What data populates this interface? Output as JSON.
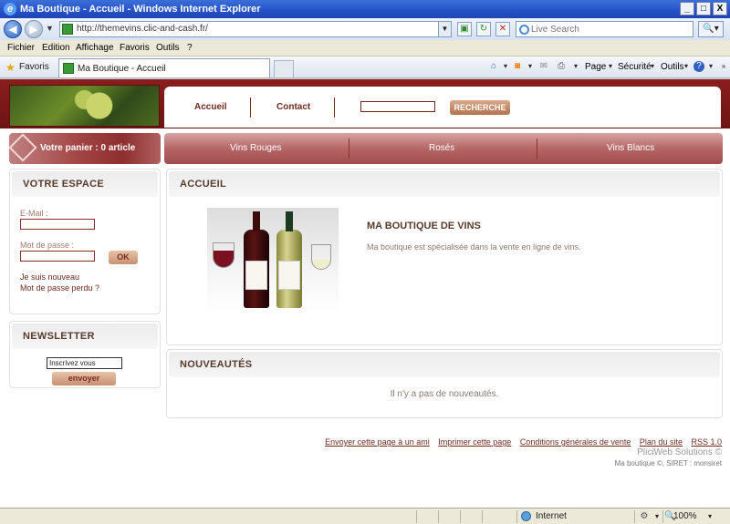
{
  "browser": {
    "window_title": "Ma Boutique - Accueil - Windows Internet Explorer",
    "window_buttons": [
      "_",
      "□",
      "X"
    ],
    "address": "http://themevins.clic-and-cash.fr/",
    "search_placeholder": "Live Search",
    "menu": [
      "Fichier",
      "Edition",
      "Affichage",
      "Favoris",
      "Outils",
      "?"
    ],
    "favorites_label": "Favoris",
    "tab_title": "Ma Boutique - Accueil",
    "commands": {
      "page": "Page",
      "security": "Sécurité",
      "tools": "Outils"
    },
    "status": {
      "zone": "Internet",
      "zoom": "100%"
    }
  },
  "site": {
    "topnav": {
      "home": "Accueil",
      "contact": "Contact",
      "search_button": "RECHERCHE"
    },
    "cart": {
      "label": "Votre panier : 0 article"
    },
    "categories": [
      "Vins Rouges",
      "Rosés",
      "Vins Blancs"
    ],
    "login": {
      "title": "VOTRE ESPACE",
      "email_label": "E-Mail :",
      "password_label": "Mot de passe :",
      "ok": "OK",
      "new_user": "Je suis nouveau",
      "lost_password": "Mot de passe perdu ?"
    },
    "newsletter": {
      "title": "NEWSLETTER",
      "input_value": "Inscrivez vous",
      "button": "envoyer"
    },
    "home": {
      "title": "ACCUEIL",
      "heading": "MA BOUTIQUE DE VINS",
      "description": "Ma boutique est spécialisée dans la vente en ligne de vins."
    },
    "news": {
      "title": "NOUVEAUTÉS",
      "empty": "Il n'y a pas de nouveautés."
    },
    "footer": {
      "links": [
        "Envoyer cette page à un ami",
        "Imprimer cette page",
        "Conditions générales de vente",
        "Plan du site",
        "RSS 1.0"
      ],
      "powered": "PliciWeb Solutions ©",
      "copyright": "Ma boutique ©, SIRET : monsiret"
    }
  },
  "colors": {
    "brand_dark": "#7a1818",
    "brand_text": "#6b2a20",
    "ie_blue": "#2552c8"
  }
}
